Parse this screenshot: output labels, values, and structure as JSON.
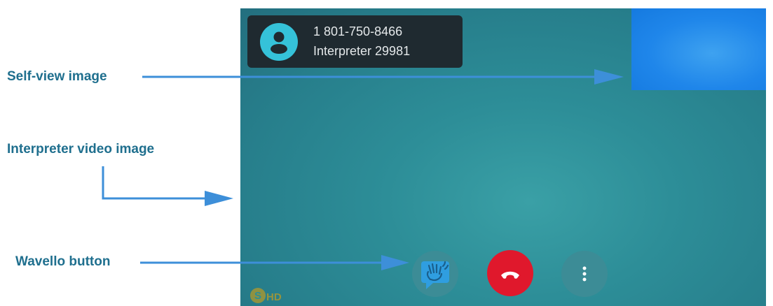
{
  "annotations": {
    "self_view": "Self-view image",
    "interpreter_video": "Interpreter video image",
    "wavello": "Wavello button"
  },
  "call": {
    "phone_number": "1 801-750-8466",
    "interpreter": "Interpreter 29981"
  },
  "logo": {
    "text": "HD",
    "icon": "signmail-s-icon"
  },
  "icons": {
    "avatar": "person-icon",
    "wavello": "waving-hand-icon",
    "hangup": "phone-hangup-icon",
    "more": "more-vertical-icon"
  },
  "colors": {
    "annotation_text": "#1f6f8e",
    "arrow": "#3d8fd9",
    "video_bg": "#2d8e98",
    "self_view": "#1f86ea",
    "hangup": "#e0182c",
    "avatar": "#35c2d9"
  }
}
